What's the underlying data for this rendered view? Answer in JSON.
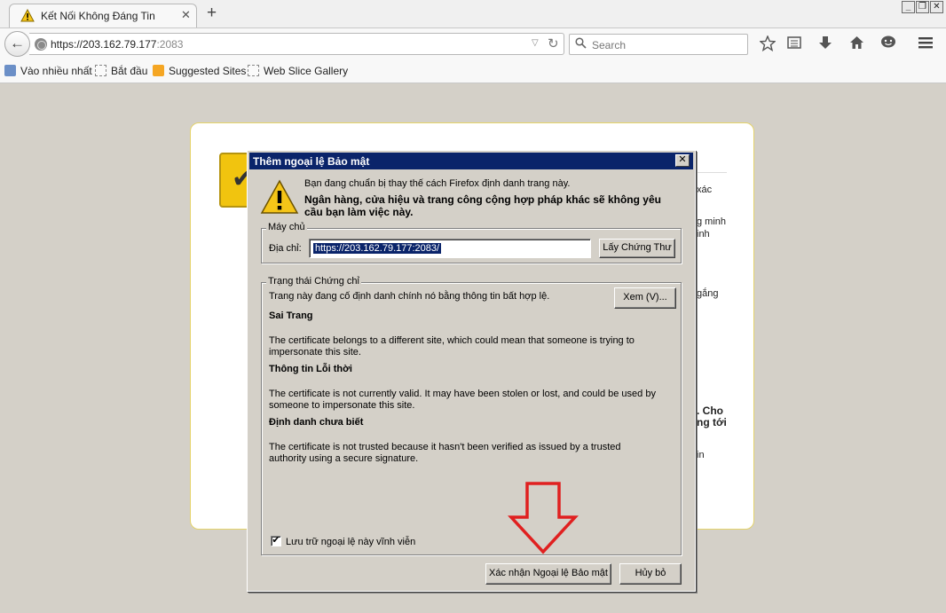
{
  "tab": {
    "title": "Kết Nối Không Đáng Tin",
    "close": "✕",
    "new_tab": "+"
  },
  "window_controls": {
    "minimize": "_",
    "restore": "❐",
    "close": "✕"
  },
  "nav": {
    "back": "←",
    "url_host": "https://203.162.79.177",
    "url_port": ":2083",
    "reload": "↻",
    "dropmarker": "▽",
    "search_placeholder": "Search",
    "search_icon": "⚲"
  },
  "toolbar_icons": [
    "bookmark-star-icon",
    "reading-list-icon",
    "downloads-icon",
    "home-icon",
    "chat-icon",
    "menu-icon"
  ],
  "bookmarks": [
    {
      "label": "Vào nhiều nhất",
      "icon": "bookmark-star-icon"
    },
    {
      "label": "Bắt đầu",
      "icon": "page-icon"
    },
    {
      "label": "Suggested Sites",
      "icon": "suggested-icon"
    },
    {
      "label": "Web Slice Gallery",
      "icon": "page-icon"
    }
  ],
  "background_fragments": [
    "xác",
    "g minh",
    "inh",
    "gắng",
    ". Cho",
    "ng tới",
    "in"
  ],
  "dialog": {
    "title": "Thêm ngoại lệ Bảo mật",
    "close": "✕",
    "intro": "Bạn đang chuẩn bị thay thế cách Firefox định danh trang này.",
    "warning": "Ngân hàng, cửa hiệu và trang công cộng hợp pháp khác sẽ không yêu cầu bạn làm việc này.",
    "server_group": "Máy chủ",
    "address_label": "Địa chỉ:",
    "address_value": "https://203.162.79.177:2083/",
    "get_cert_button": "Lấy Chứng Thư",
    "status_group": "Trạng thái Chứng chỉ",
    "status_desc": "Trang này đang cố định danh chính nó bằng thông tin bất hợp lệ.",
    "view_button": "Xem (V)...",
    "issues": [
      {
        "title": "Sai Trang",
        "body": "The certificate belongs to a different site, which could mean that someone is trying to impersonate this site."
      },
      {
        "title": "Thông tin Lỗi thời",
        "body": "The certificate is not currently valid. It may have been stolen or lost, and could be used by someone to impersonate this site."
      },
      {
        "title": "Định danh chưa biết",
        "body": "The certificate is not trusted because it hasn't been verified as issued by a trusted authority using a secure signature."
      }
    ],
    "permanent_checked": true,
    "permanent_check_mark": "✔",
    "permanent_label": "Lưu trữ ngoại lệ này vĩnh viễn",
    "confirm_button": "Xác nhận Ngoại lệ Bảo mật",
    "cancel_button": "Hủy bỏ"
  },
  "colors": {
    "dialog_title_bg": "#0a246a",
    "annotation_arrow": "#e02020",
    "error_box_border": "#e5d36a"
  }
}
